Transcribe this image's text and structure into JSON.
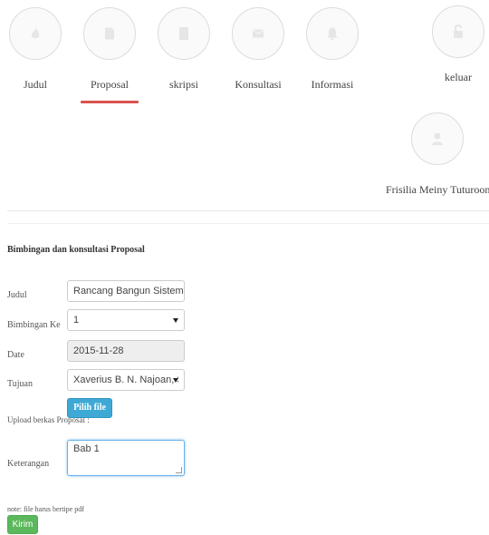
{
  "nav": {
    "items": [
      {
        "label": "Judul",
        "icon": "fire-icon"
      },
      {
        "label": "Proposal",
        "icon": "file-icon"
      },
      {
        "label": "skripsi",
        "icon": "book-icon"
      },
      {
        "label": "Konsultasi",
        "icon": "envelope-icon"
      },
      {
        "label": "Informasi",
        "icon": "bell-icon"
      }
    ],
    "logout": {
      "label": "keluar",
      "icon": "lock-icon"
    },
    "user": {
      "name": "Frisilia Meiny Tuturoong",
      "icon": "user-icon"
    },
    "active_color": "#d9534f"
  },
  "form": {
    "title": "Bimbingan dan konsultasi Proposal",
    "judul": {
      "label": "Judul",
      "value": "Rancang Bangun Sistem Informa"
    },
    "bimbingan": {
      "label": "Bimbingan Ke",
      "value": "1"
    },
    "date": {
      "label": "Date",
      "value": "2015-11-28"
    },
    "tujuan": {
      "label": "Tujuan",
      "value": "Xaverius B. N. Najoan, ST, I"
    },
    "upload": {
      "label": "Upload berkas Proposal :",
      "button": "Pilih file"
    },
    "keterangan": {
      "label": "Keterangan",
      "value": "Bab 1"
    },
    "note": "note: file harus bertipe pdf",
    "submit": "Kirim"
  },
  "colors": {
    "primary": "#3fa9d6",
    "success": "#5cb85c",
    "focus": "#66afe9"
  }
}
